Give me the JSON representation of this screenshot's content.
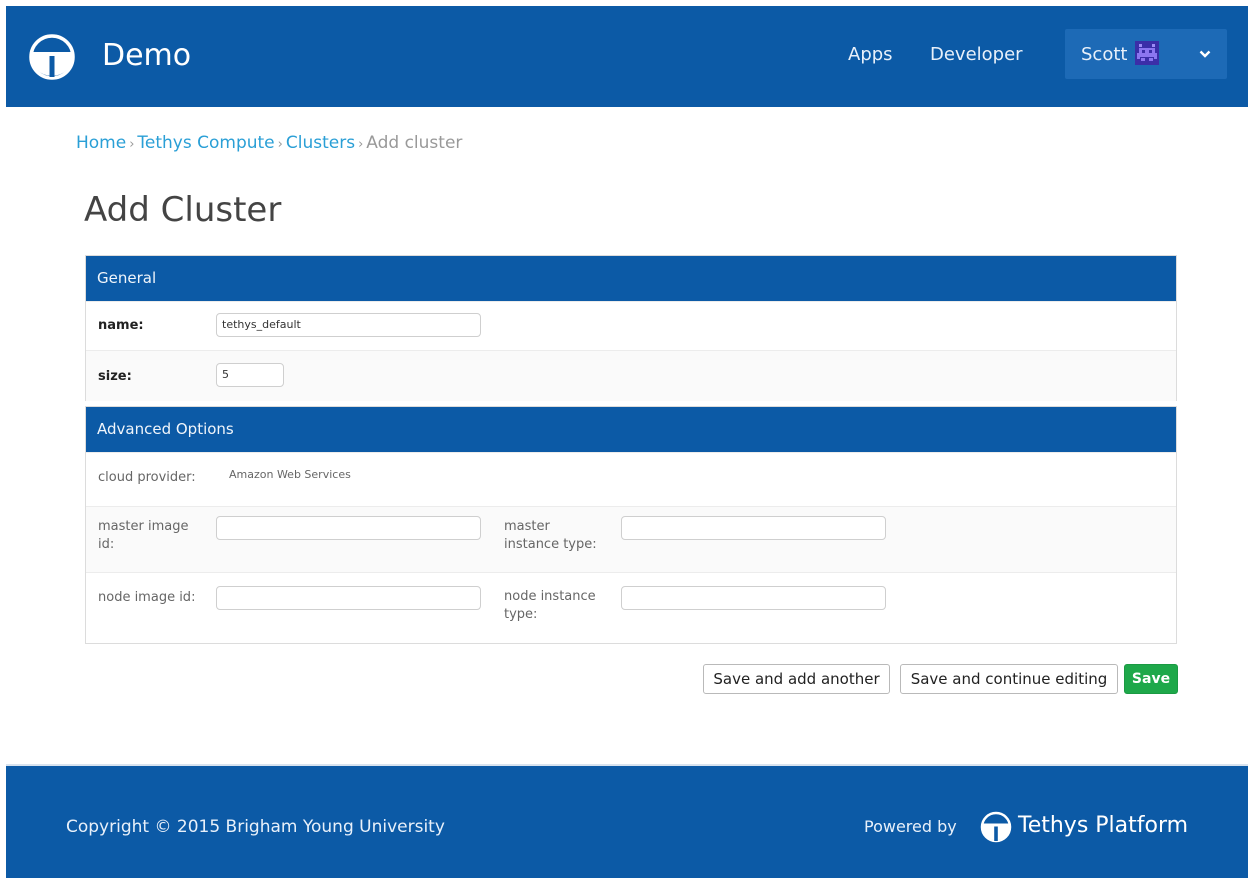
{
  "header": {
    "app_title": "Demo",
    "nav": {
      "apps": "Apps",
      "developer": "Developer"
    },
    "user": {
      "name": "Scott"
    }
  },
  "breadcrumb": {
    "home": "Home",
    "compute": "Tethys Compute",
    "clusters": "Clusters",
    "current": "Add cluster",
    "separator": "›"
  },
  "page_title": "Add Cluster",
  "general": {
    "heading": "General",
    "name_label": "name:",
    "name_value": "tethys_default",
    "size_label": "size:",
    "size_value": "5"
  },
  "advanced": {
    "heading": "Advanced Options",
    "cloud_provider_label": "cloud provider:",
    "cloud_provider_value": "Amazon Web Services",
    "master_image_id_label_1": "master image",
    "master_image_id_label_2": "id:",
    "master_image_id_value": "",
    "master_instance_type_label_1": "master",
    "master_instance_type_label_2": "instance type:",
    "master_instance_type_value": "",
    "node_image_id_label": "node image id:",
    "node_image_id_value": "",
    "node_instance_type_label_1": "node instance",
    "node_instance_type_label_2": "type:",
    "node_instance_type_value": ""
  },
  "actions": {
    "save_add_another": "Save and add another",
    "save_continue": "Save and continue editing",
    "save": "Save"
  },
  "footer": {
    "copyright": "Copyright © 2015 Brigham Young University",
    "powered_by": "Powered by",
    "platform": "Tethys Platform"
  },
  "colors": {
    "brand_blue": "#0c5aa6",
    "link_blue": "#2a9fd6",
    "save_green": "#1ea84a"
  },
  "icons": {
    "logo": "tethys-logo-icon",
    "avatar": "space-invader-avatar-icon",
    "user_menu": "chevron-down-icon"
  }
}
